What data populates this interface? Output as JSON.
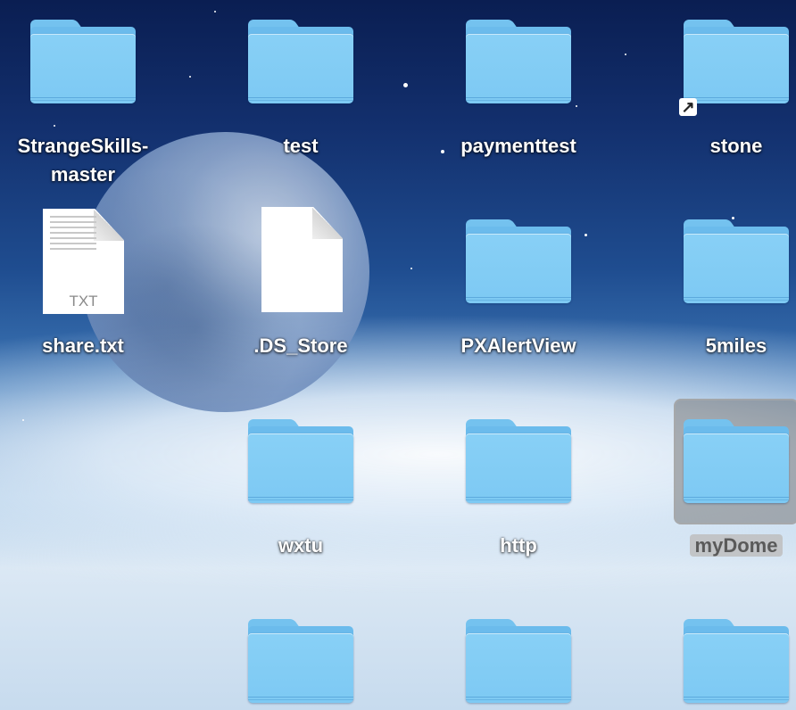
{
  "desktop": {
    "items": [
      {
        "name": "StrangeSkills-\nmaster",
        "line1": "StrangeSkills-",
        "line2": "master",
        "kind": "folder"
      },
      {
        "name": "test",
        "kind": "folder"
      },
      {
        "name": "paymenttest",
        "kind": "folder"
      },
      {
        "name": "stone",
        "kind": "folder-alias"
      },
      {
        "name": "share.txt",
        "kind": "txt-file",
        "type_label": "TXT"
      },
      {
        "name": ".DS_Store",
        "kind": "document"
      },
      {
        "name": "PXAlertView",
        "kind": "folder"
      },
      {
        "name": "5miles",
        "kind": "folder"
      },
      {
        "name": "wxtu",
        "kind": "folder"
      },
      {
        "name": "http",
        "kind": "folder"
      },
      {
        "name": "myDome",
        "kind": "folder",
        "selected": true
      },
      {
        "name": "",
        "kind": "folder"
      },
      {
        "name": "",
        "kind": "folder"
      },
      {
        "name": "",
        "kind": "folder"
      }
    ]
  },
  "icons": {
    "folder": "folder-icon",
    "document": "document-icon",
    "alias": "alias-arrow-icon"
  },
  "colors": {
    "folder": "#7dc9f3",
    "selection": "#8a8a8a"
  }
}
